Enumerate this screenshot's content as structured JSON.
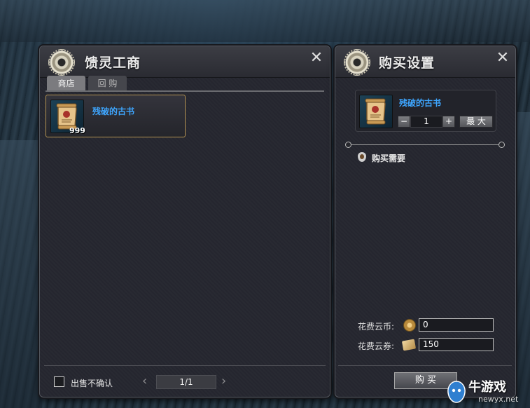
{
  "shop_panel": {
    "title": "馈灵工商",
    "tabs": [
      {
        "label": "商店",
        "active": true
      },
      {
        "label": "回 购",
        "active": false
      }
    ],
    "items": [
      {
        "name": "残破的古书",
        "count": "999",
        "icon": "ancient-scroll-icon"
      }
    ],
    "footer": {
      "checkbox_label": "出售不确认",
      "checkbox_checked": false,
      "page": "1/1"
    }
  },
  "purchase_panel": {
    "title": "购买设置",
    "item_name": "残破的古书",
    "quantity": "1",
    "max_label": "最 大",
    "section_title": "购买需要",
    "costs": [
      {
        "label": "花费云币:",
        "icon": "cloud-coin-icon",
        "value": "0"
      },
      {
        "label": "花费云券:",
        "icon": "cloud-voucher-icon",
        "value": "150"
      }
    ],
    "buy_label": "购 买"
  },
  "watermark": {
    "brand": "牛游戏",
    "site": "newyx.net"
  },
  "colors": {
    "panel_bg": "#262730",
    "item_name": "#3ea6ff",
    "selected_border": "#b59452"
  }
}
